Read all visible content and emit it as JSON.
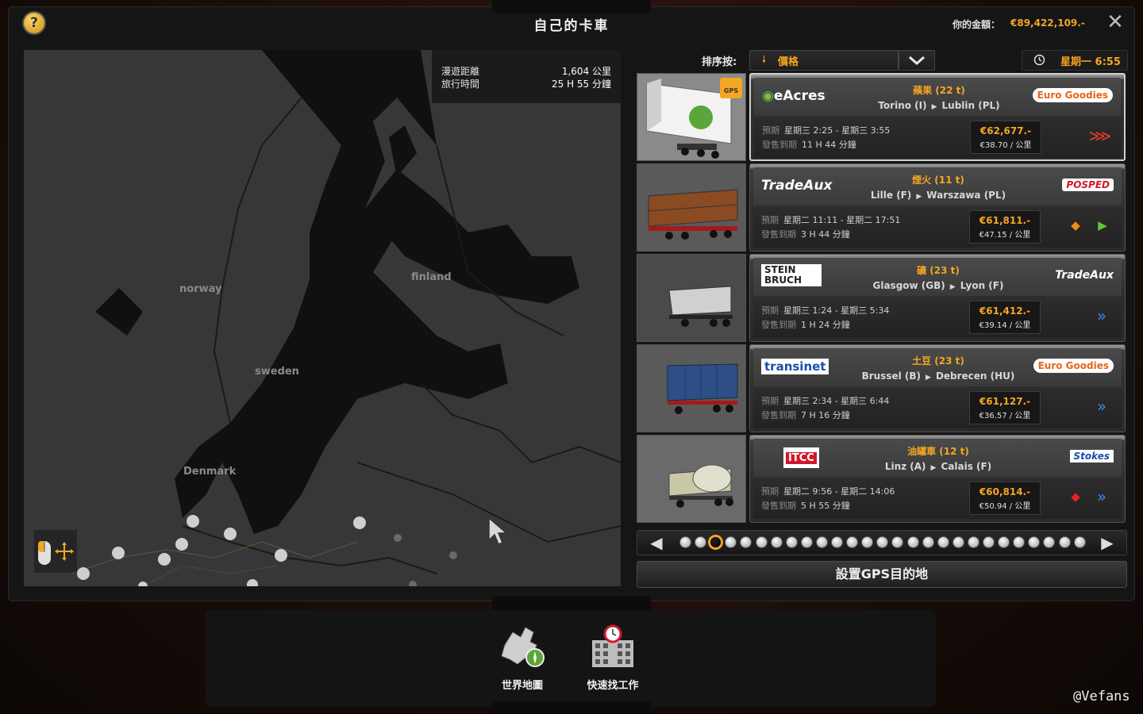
{
  "window": {
    "title": "自己的卡車",
    "money_label": "你的金額：",
    "money_value": "€89,422,109.-"
  },
  "map": {
    "route_distance_label": "漫遊距離",
    "route_distance_value": "1,604 公里",
    "route_time_label": "旅行時間",
    "route_time_value": "25 H 55 分鐘",
    "labels": {
      "norway": "norway",
      "sweden": "sweden",
      "finland": "finland",
      "denmark": "Denmark"
    }
  },
  "sort": {
    "label": "排序按:",
    "value": "價格"
  },
  "clock": {
    "time": "星期一 6:55"
  },
  "jobs": [
    {
      "cargo": "蘋果 (22 t)",
      "origin": "Torino (I)",
      "destination": "Lublin (PL)",
      "expected_label": "預期",
      "expected": "星期三 2:25 - 星期三 3:55",
      "expires_label": "發售到期",
      "expires": "11 H 44 分鐘",
      "pay": "€62,677.-",
      "per_km": "€38.70 / 公里",
      "company_from": "eAcres",
      "company_to": "Euro Goodies",
      "urgency": "⋙"
    },
    {
      "cargo": "煙火 (11 t)",
      "origin": "Lille (F)",
      "destination": "Warszawa (PL)",
      "expected_label": "預期",
      "expected": "星期二 11:11 - 星期二 17:51",
      "expires_label": "發售到期",
      "expires": "3 H 44 分鐘",
      "pay": "€61,811.-",
      "per_km": "€47.15 / 公里",
      "company_from": "TradeAux",
      "company_to": "POSPED",
      "urgency": "▶"
    },
    {
      "cargo": "礦 (23 t)",
      "origin": "Glasgow (GB)",
      "destination": "Lyon (F)",
      "expected_label": "預期",
      "expected": "星期三 1:24 - 星期三 5:34",
      "expires_label": "發售到期",
      "expires": "1 H 24 分鐘",
      "pay": "€61,412.-",
      "per_km": "€39.14 / 公里",
      "company_from": "STEIN BRUCH",
      "company_to": "TradeAux",
      "urgency": "»"
    },
    {
      "cargo": "土豆 (23 t)",
      "origin": "Brussel (B)",
      "destination": "Debrecen (HU)",
      "expected_label": "預期",
      "expected": "星期三 2:34 - 星期三 6:44",
      "expires_label": "發售到期",
      "expires": "7 H 16 分鐘",
      "pay": "€61,127.-",
      "per_km": "€36.57 / 公里",
      "company_from": "transinet",
      "company_to": "Euro Goodies",
      "urgency": "»"
    },
    {
      "cargo": "油罐車 (12 t)",
      "origin": "Linz (A)",
      "destination": "Calais (F)",
      "expected_label": "預期",
      "expected": "星期二 9:56 - 星期二 14:06",
      "expires_label": "發售到期",
      "expires": "5 H 55 分鐘",
      "pay": "€60,814.-",
      "per_km": "€50.94 / 公里",
      "company_from": "ITCC",
      "company_to": "Stokes",
      "urgency": "»"
    }
  ],
  "pager": {
    "current_page": 3,
    "total_pages": 27
  },
  "gps_button": "設置GPS目的地",
  "bottom": {
    "world_map": "世界地圖",
    "quick_job": "快速找工作"
  },
  "watermark": "@Vefans",
  "colors": {
    "accent": "#f5a623",
    "panel": "#151515"
  }
}
